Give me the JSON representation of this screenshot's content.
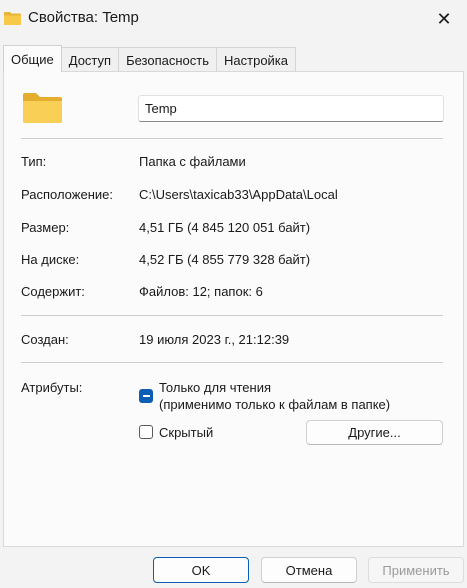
{
  "window": {
    "title": "Свойства: Temp",
    "close_glyph": "✕"
  },
  "tabs": [
    {
      "label": "Общие",
      "active": true
    },
    {
      "label": "Доступ",
      "active": false
    },
    {
      "label": "Безопасность",
      "active": false
    },
    {
      "label": "Настройка",
      "active": false
    }
  ],
  "general": {
    "name_value": "Temp",
    "rows": {
      "type": {
        "label": "Тип:",
        "value": "Папка с файлами"
      },
      "location": {
        "label": "Расположение:",
        "value": "C:\\Users\\taxicab33\\AppData\\Local"
      },
      "size": {
        "label": "Размер:",
        "value": "4,51 ГБ (4 845 120 051 байт)"
      },
      "on_disk": {
        "label": "На диске:",
        "value": "4,52 ГБ (4 855 779 328 байт)"
      },
      "contains": {
        "label": "Содержит:",
        "value": "Файлов: 12; папок: 6"
      },
      "created": {
        "label": "Создан:",
        "value": "19 июля 2023 г., 21:12:39"
      }
    },
    "attributes": {
      "label": "Атрибуты:",
      "readonly_line1": "Только для чтения",
      "readonly_line2": "(применимо только к файлам в папке)",
      "readonly_state": "indeterminate",
      "hidden_label": "Скрытый",
      "hidden_checked": false,
      "other_button": "Другие..."
    }
  },
  "footer": {
    "ok": "OK",
    "cancel": "Отмена",
    "apply": "Применить"
  },
  "colors": {
    "accent": "#0a5fb4",
    "folder": "#f7c948"
  }
}
